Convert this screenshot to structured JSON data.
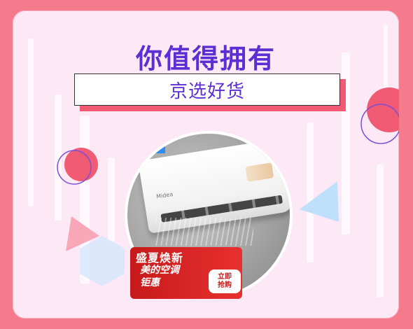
{
  "header": {
    "title": "你值得拥有",
    "subtitle": "京选好货"
  },
  "product": {
    "brand_mark": "Midea",
    "promo_line1": "盛夏焕新",
    "promo_line2": "美的空调",
    "promo_line3": "钜惠",
    "buy_line1": "立即",
    "buy_line2": "抢购"
  },
  "colors": {
    "page_bg": "#f47a8c",
    "card_bg": "#fde9f6",
    "title": "#5b2fd3",
    "accent_red": "#f05a72",
    "promo_red": "#c71a1a"
  }
}
